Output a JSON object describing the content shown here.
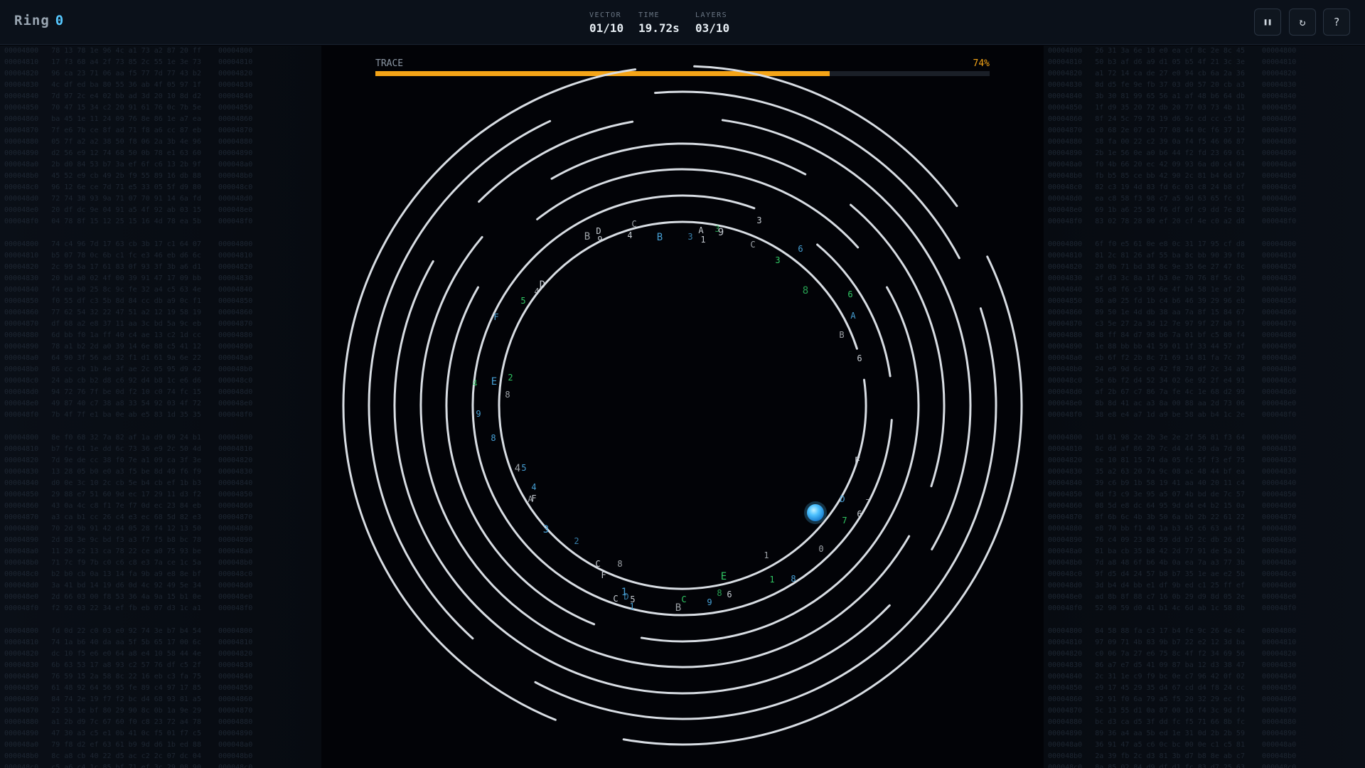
{
  "header": {
    "brand": "Ring",
    "ring_index": "0",
    "stats": [
      {
        "label": "VECTOR",
        "value": "01/10"
      },
      {
        "label": "TIME",
        "value": "19.72s"
      },
      {
        "label": "LAYERS",
        "value": "03/10"
      }
    ],
    "buttons": [
      {
        "name": "pause-button",
        "icon": "pause-icon",
        "glyph": "❚❚"
      },
      {
        "name": "restart-button",
        "icon": "restart-icon",
        "glyph": "↻"
      },
      {
        "name": "help-button",
        "icon": "help-icon",
        "glyph": "?"
      }
    ]
  },
  "trace": {
    "label": "TRACE",
    "percent_text": "74%",
    "progress": 0.74
  },
  "colors": {
    "accent": "#f4a417",
    "ball": "#4fc3ff",
    "ring": "#d8dde3",
    "hex_green": "#33d46a",
    "hex_blue": "#4aa8e0"
  },
  "glyphs": [
    {
      "t": "B",
      "c": "w"
    },
    {
      "t": "D",
      "c": "w"
    },
    {
      "t": "9",
      "c": "w"
    },
    {
      "t": "C",
      "c": "w"
    },
    {
      "t": "4",
      "c": "w"
    },
    {
      "t": "B",
      "c": "b"
    },
    {
      "t": "3",
      "c": "b"
    },
    {
      "t": "A",
      "c": "w"
    },
    {
      "t": "1",
      "c": "w"
    },
    {
      "t": "3",
      "c": "g"
    },
    {
      "t": "9",
      "c": "w"
    },
    {
      "t": "3",
      "c": "w"
    },
    {
      "t": "C",
      "c": "w"
    },
    {
      "t": "6",
      "c": "b"
    },
    {
      "t": "3",
      "c": "g"
    },
    {
      "t": "8",
      "c": "g"
    },
    {
      "t": "6",
      "c": "g"
    },
    {
      "t": "A",
      "c": "b"
    },
    {
      "t": "B",
      "c": "w"
    },
    {
      "t": "6",
      "c": "w"
    },
    {
      "t": "D",
      "c": "w"
    },
    {
      "t": "4",
      "c": "w"
    },
    {
      "t": "5",
      "c": "g"
    },
    {
      "t": "F",
      "c": "b"
    },
    {
      "t": "4",
      "c": "g"
    },
    {
      "t": "E",
      "c": "b"
    },
    {
      "t": "2",
      "c": "g"
    },
    {
      "t": "8",
      "c": "w"
    },
    {
      "t": "9",
      "c": "b"
    },
    {
      "t": "8",
      "c": "b"
    },
    {
      "t": "4",
      "c": "w"
    },
    {
      "t": "5",
      "c": "b"
    },
    {
      "t": "4",
      "c": "b"
    },
    {
      "t": "A",
      "c": "w"
    },
    {
      "t": "F",
      "c": "w"
    },
    {
      "t": "3",
      "c": "b"
    },
    {
      "t": "2",
      "c": "b"
    },
    {
      "t": "C",
      "c": "w"
    },
    {
      "t": "F",
      "c": "w"
    },
    {
      "t": "8",
      "c": "w"
    },
    {
      "t": "1",
      "c": "b"
    },
    {
      "t": "C",
      "c": "w"
    },
    {
      "t": "D",
      "c": "b"
    },
    {
      "t": "5",
      "c": "w"
    },
    {
      "t": "1",
      "c": "b"
    },
    {
      "t": "B",
      "c": "w"
    },
    {
      "t": "C",
      "c": "g"
    },
    {
      "t": "9",
      "c": "b"
    },
    {
      "t": "8",
      "c": "g"
    },
    {
      "t": "6",
      "c": "w"
    },
    {
      "t": "E",
      "c": "g"
    },
    {
      "t": "1",
      "c": "w"
    },
    {
      "t": "1",
      "c": "g"
    },
    {
      "t": "8",
      "c": "b"
    },
    {
      "t": "0",
      "c": "w"
    },
    {
      "t": "F",
      "c": "w"
    },
    {
      "t": "D",
      "c": "b"
    },
    {
      "t": "7",
      "c": "w"
    },
    {
      "t": "6",
      "c": "w"
    },
    {
      "t": "7",
      "c": "g"
    }
  ]
}
